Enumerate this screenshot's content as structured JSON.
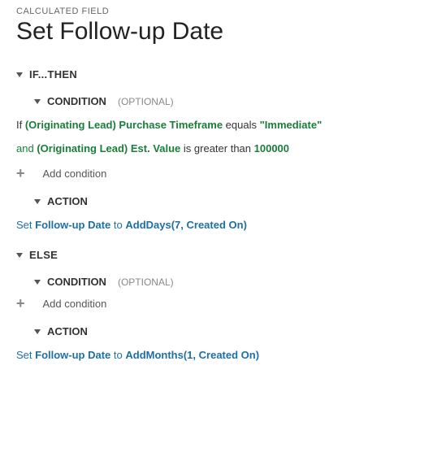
{
  "header": {
    "label": "CALCULATED FIELD",
    "title": "Set Follow-up Date"
  },
  "ifBlock": {
    "heading": "IF...THEN",
    "condition": {
      "heading": "CONDITION",
      "optional": "(OPTIONAL)",
      "line1": {
        "prefix": "If ",
        "field": "(Originating Lead) Purchase Timeframe",
        "operator": " equals ",
        "value": "\"Immediate\""
      },
      "line2": {
        "prefix": "and ",
        "field": "(Originating Lead) Est. Value",
        "operator": " is greater than ",
        "value": "100000"
      },
      "addLabel": "Add condition"
    },
    "action": {
      "heading": "ACTION",
      "line": {
        "prefix": "Set ",
        "target": "Follow-up Date",
        "to": " to ",
        "func": "AddDays(7, Created On)"
      }
    }
  },
  "elseBlock": {
    "heading": "ELSE",
    "condition": {
      "heading": "CONDITION",
      "optional": "(OPTIONAL)",
      "addLabel": "Add condition"
    },
    "action": {
      "heading": "ACTION",
      "line": {
        "prefix": "Set ",
        "target": "Follow-up Date",
        "to": " to ",
        "func": "AddMonths(1, Created On)"
      }
    }
  }
}
